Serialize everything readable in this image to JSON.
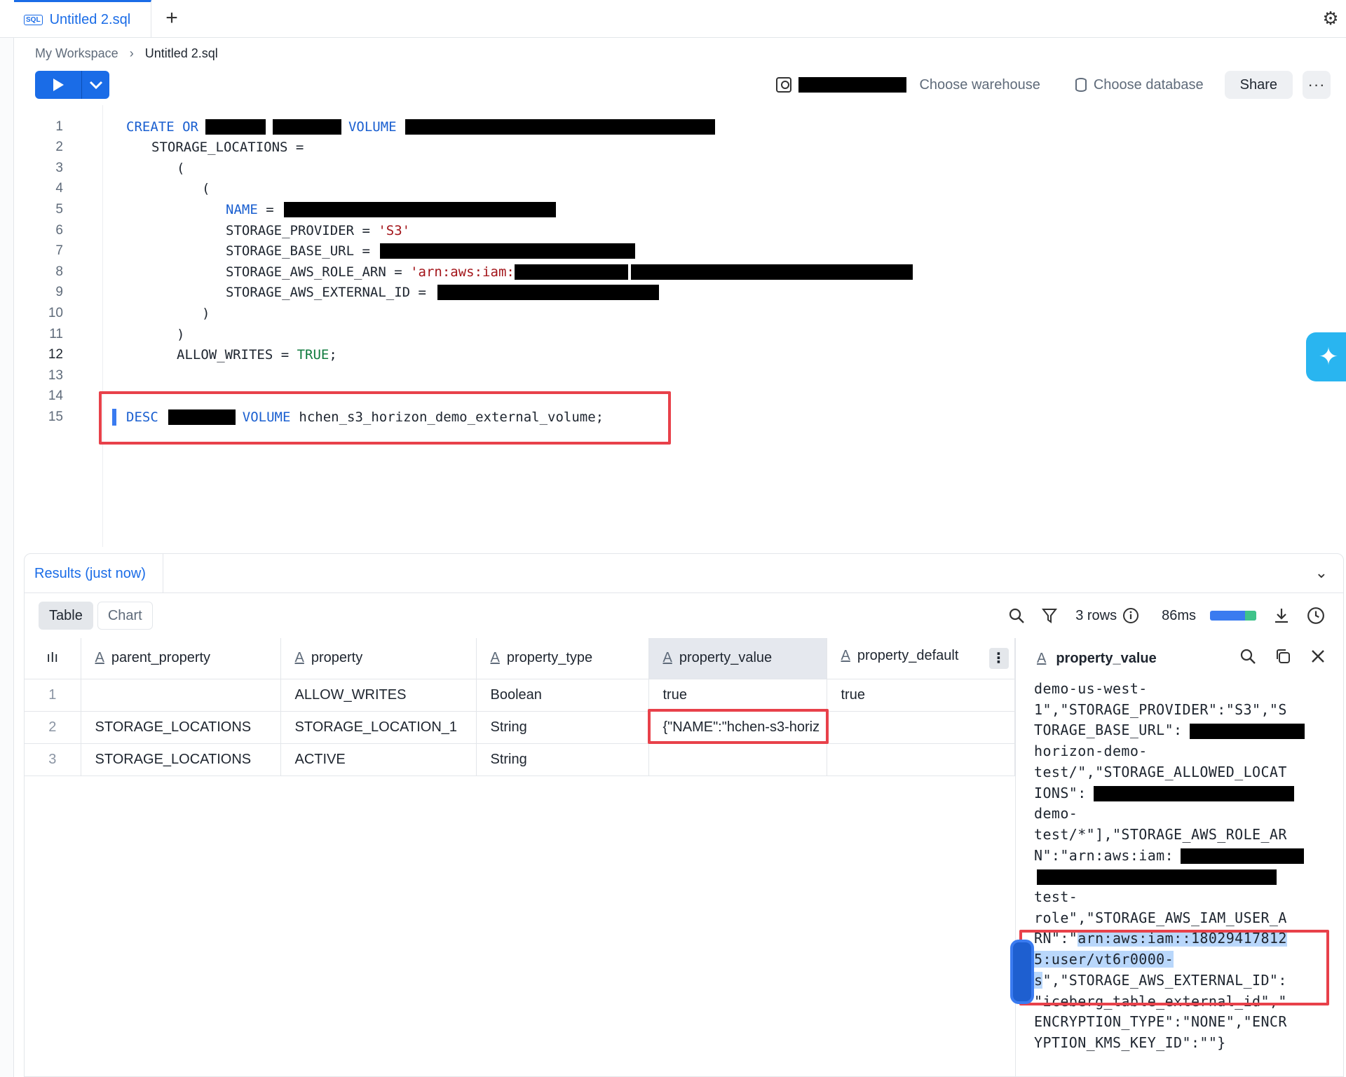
{
  "tab": {
    "title": "Untitled 2.sql",
    "icon": "sql-icon"
  },
  "breadcrumb": {
    "root": "My Workspace",
    "current": "Untitled 2.sql"
  },
  "toolbar": {
    "warehouse": "Choose warehouse",
    "database": "Choose database",
    "share": "Share",
    "more": "···"
  },
  "editor": {
    "line_numbers": [
      "1",
      "2",
      "3",
      "4",
      "5",
      "6",
      "7",
      "8",
      "9",
      "10",
      "11",
      "12",
      "13",
      "14",
      "15"
    ],
    "active_line": 12,
    "lines": {
      "l1_a": "CREATE OR",
      "l1_b": "VOLUME",
      "l2": "STORAGE_LOCATIONS =",
      "l3": "(",
      "l4": "(",
      "l5_key": "NAME",
      "l5_eq": " =",
      "l6_key": "STORAGE_PROVIDER = ",
      "l6_val": "'S3'",
      "l7_key": "STORAGE_BASE_URL =",
      "l8_key": "STORAGE_AWS_ROLE_ARN = ",
      "l8_val": "'arn:aws:iam:",
      "l9_key": "STORAGE_AWS_EXTERNAL_ID =",
      "l10": ")",
      "l11": ")",
      "l12_key": "ALLOW_WRITES = ",
      "l12_val": "TRUE",
      "l12_end": ";",
      "l15_kw": "DESC",
      "l15_kw2": "VOLUME",
      "l15_name": "hchen_s3_horizon_demo_external_volume;"
    }
  },
  "results": {
    "tab_label": "Results (just now)",
    "views": [
      "Table",
      "Chart"
    ],
    "active_view": "Table",
    "row_count": "3 rows",
    "duration": "86ms",
    "columns": [
      "parent_property",
      "property",
      "property_type",
      "property_value",
      "property_default"
    ],
    "column_type_icon": "A",
    "rows": [
      {
        "n": "1",
        "parent_property": "",
        "property": "ALLOW_WRITES",
        "property_type": "Boolean",
        "property_value": "true",
        "property_default": "true"
      },
      {
        "n": "2",
        "parent_property": "STORAGE_LOCATIONS",
        "property": "STORAGE_LOCATION_1",
        "property_type": "String",
        "property_value": "{\"NAME\":\"hchen-s3-horiz",
        "property_default": ""
      },
      {
        "n": "3",
        "parent_property": "STORAGE_LOCATIONS",
        "property": "ACTIVE",
        "property_type": "String",
        "property_value": "",
        "property_default": ""
      }
    ],
    "selected_column": "property_value"
  },
  "detail": {
    "title": "property_value",
    "lines": {
      "a1": "demo-us-west-",
      "a2": "1\",\"STORAGE_PROVIDER\":\"S3\",\"S",
      "a3": "TORAGE_BASE_URL\":",
      "a4": "horizon-demo-",
      "a5": "test/\",\"STORAGE_ALLOWED_LOCAT",
      "a6": "IONS\":",
      "a7": "demo-",
      "a8": "test/*\"],\"STORAGE_AWS_ROLE_AR",
      "a9": "N\":\"arn:aws:iam:",
      "a11": "test-",
      "a12": "role\",\"STORAGE_AWS_IAM_USER_A",
      "a13_pre": "RN\":\"",
      "a13_sel": "arn:aws:iam::18029417812",
      "a14_sel": "5:user/vt6r0000-",
      "a15_sel": "s",
      "a15_post": "\",\"STORAGE_AWS_EXTERNAL_ID\":",
      "a16": "\"iceberg_table_external_id\",\"",
      "a17": "ENCRYPTION_TYPE\":\"NONE\",\"ENCR",
      "a18": "YPTION_KMS_KEY_ID\":\"\"}"
    }
  },
  "colors": {
    "accent": "#1a6ce7",
    "highlight_box": "#e8414a",
    "ai_button": "#29b5f0"
  }
}
